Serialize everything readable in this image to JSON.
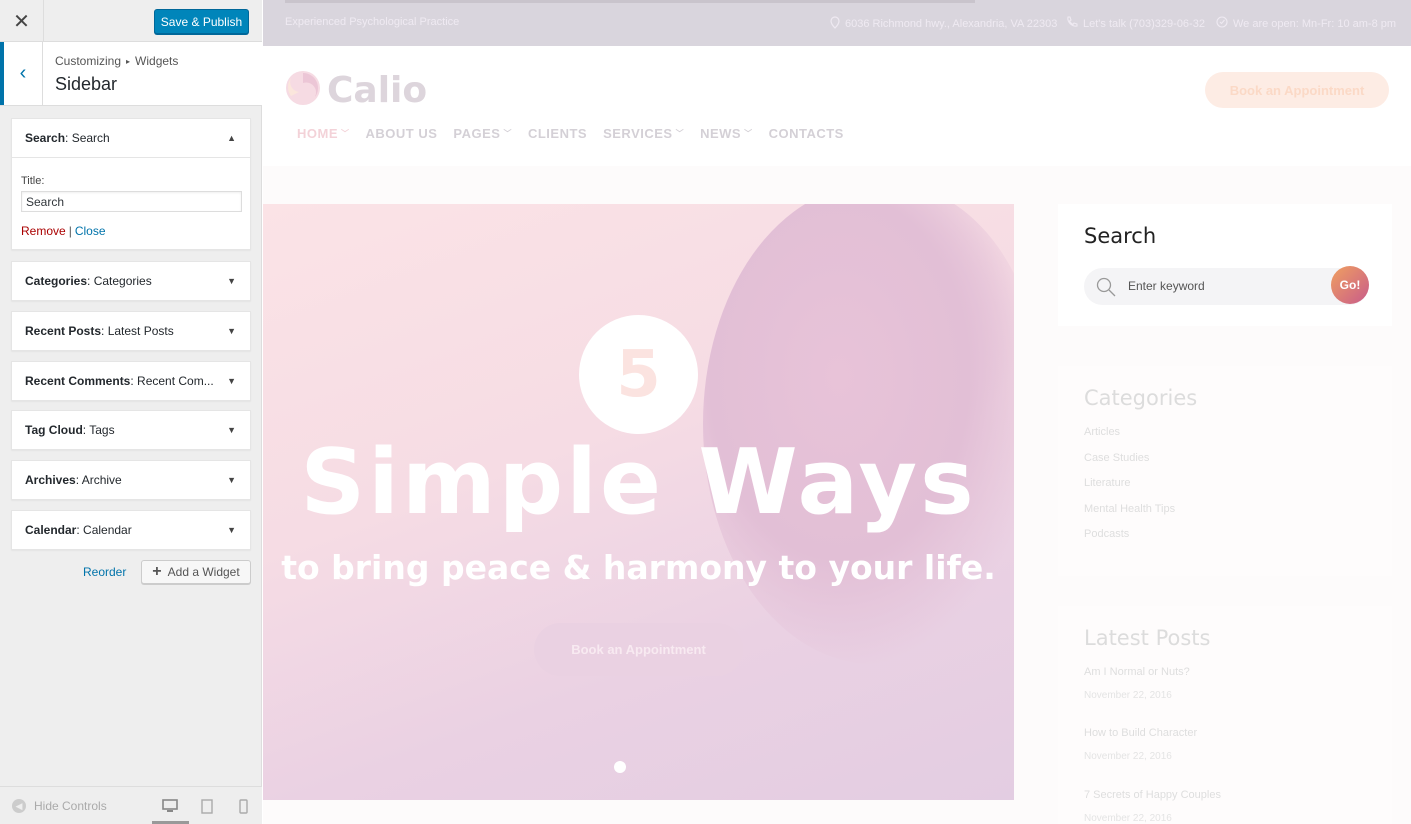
{
  "customizer": {
    "close_icon": "close-icon",
    "save_label": "Save & Publish",
    "breadcrumb_root": "Customizing",
    "breadcrumb_leaf": "Widgets",
    "section_title": "Sidebar",
    "search_widget": {
      "type": "Search",
      "name": "Search",
      "title_label": "Title:",
      "title_value": "Search",
      "remove_label": "Remove",
      "close_label": "Close"
    },
    "widgets": [
      {
        "type": "Categories",
        "name": "Categories"
      },
      {
        "type": "Recent Posts",
        "name": "Latest Posts"
      },
      {
        "type": "Recent Comments",
        "name": "Recent Com..."
      },
      {
        "type": "Tag Cloud",
        "name": "Tags"
      },
      {
        "type": "Archives",
        "name": "Archive"
      },
      {
        "type": "Calendar",
        "name": "Calendar"
      }
    ],
    "reorder_label": "Reorder",
    "add_widget_label": "Add a Widget",
    "hide_controls_label": "Hide Controls",
    "accent_color": "#0085ba"
  },
  "preview": {
    "tagline": "Experienced Psychological Practice",
    "address": "6036 Richmond hwy., Alexandria, VA 22303",
    "phone": "Let's talk (703)329-06-32",
    "hours": "We are open: Mn-Fr: 10 am-8 pm",
    "logo_text": "Calio",
    "header_button": "Book an Appointment",
    "nav": [
      {
        "label": "HOME",
        "dropdown": true
      },
      {
        "label": "ABOUT US",
        "dropdown": false
      },
      {
        "label": "PAGES",
        "dropdown": true
      },
      {
        "label": "CLIENTS",
        "dropdown": false
      },
      {
        "label": "SERVICES",
        "dropdown": true
      },
      {
        "label": "NEWS",
        "dropdown": true
      },
      {
        "label": "CONTACTS",
        "dropdown": false
      }
    ],
    "hero": {
      "number": "5",
      "title": "Simple Ways",
      "subtitle": "to bring peace & harmony to your life.",
      "button": "Book an Appointment"
    },
    "sidebar": {
      "search_title": "Search",
      "search_placeholder": "Enter keyword",
      "search_button": "Go!",
      "categories_title": "Categories",
      "categories": [
        "Articles",
        "Case Studies",
        "Literature",
        "Mental Health Tips",
        "Podcasts"
      ],
      "posts_title": "Latest Posts",
      "posts": [
        {
          "title": "Am I Normal or Nuts?",
          "date": "November 22, 2016"
        },
        {
          "title": "How to Build Character",
          "date": "November 22, 2016"
        },
        {
          "title": "7 Secrets of Happy Couples",
          "date": "November 22, 2016"
        }
      ]
    }
  }
}
